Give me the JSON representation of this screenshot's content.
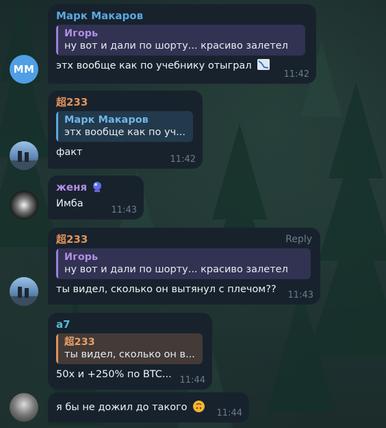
{
  "messages": [
    {
      "avatar_initials": "MM",
      "author": "Марк Макаров",
      "reply_to": {
        "author": "Игорь",
        "text": "ну вот и дали по шорту... красиво залетел"
      },
      "text": "этх вообще как по учебнику отыграл",
      "icon": "chart-down-icon",
      "time": "11:42"
    },
    {
      "author": "超233",
      "reply_to": {
        "author": "Марк Макаров",
        "text": "этх вообще как по уч..."
      },
      "text": "факт",
      "time": "11:42"
    },
    {
      "author": "женя",
      "author_icon": "crystal-ball-icon",
      "text": "Имба",
      "time": "11:43"
    },
    {
      "author": "超233",
      "reply_action": "Reply",
      "reply_to": {
        "author": "Игорь",
        "text": "ну вот и дали по шорту... красиво залетел"
      },
      "text": "ты видел, сколько он вытянул с плечом??",
      "time": "11:43"
    },
    {
      "author": "a7",
      "reply_to": {
        "author": "超233",
        "text": "ты видел, сколько он в..."
      },
      "text": "50x и +250% по BTC...",
      "time": "11:44"
    },
    {
      "text": "я бы не дожил до такого",
      "emoji": "upside-down-face-icon",
      "time": "11:44"
    }
  ]
}
